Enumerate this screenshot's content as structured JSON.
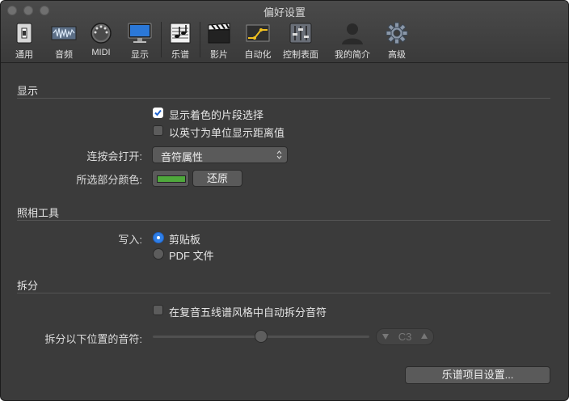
{
  "window": {
    "title": "偏好设置"
  },
  "toolbar": {
    "items": [
      {
        "label": "通用",
        "icon": "general-switch-icon"
      },
      {
        "label": "音频",
        "icon": "audio-waveform-icon"
      },
      {
        "label": "MIDI",
        "icon": "midi-connector-icon"
      },
      {
        "label": "显示",
        "icon": "display-monitor-icon"
      },
      {
        "label": "乐谱",
        "icon": "music-score-icon"
      },
      {
        "label": "影片",
        "icon": "film-clapper-icon"
      },
      {
        "label": "自动化",
        "icon": "automation-icon"
      },
      {
        "label": "控制表面",
        "icon": "control-surface-icon"
      },
      {
        "label": "我的简介",
        "icon": "my-profile-icon"
      },
      {
        "label": "高级",
        "icon": "advanced-gear-icon"
      }
    ],
    "selected": "乐谱"
  },
  "sections": {
    "display": {
      "title": "显示",
      "show_colored_selection": {
        "label": "显示着色的片段选择",
        "checked": true
      },
      "show_inch_distance": {
        "label": "以英寸为单位显示距离值",
        "checked": false
      },
      "double_click_opens": {
        "label": "连按会打开:",
        "value": "音符属性"
      },
      "selection_color": {
        "label": "所选部分颜色:",
        "color": "#4fa83c",
        "reset_label": "还原"
      }
    },
    "camera": {
      "title": "照相工具",
      "write_to": {
        "label": "写入:",
        "options": [
          "剪贴板",
          "PDF 文件"
        ],
        "selected": "剪贴板"
      }
    },
    "split": {
      "title": "拆分",
      "auto_split": {
        "label": "在复音五线谱风格中自动拆分音符",
        "checked": false
      },
      "split_below": {
        "label": "拆分以下位置的音符:",
        "value": "C3",
        "slider_fraction": 0.5
      }
    }
  },
  "footer": {
    "score_project_settings": "乐谱项目设置..."
  },
  "colors": {
    "window_bg": "#3b3b3b",
    "accent": "#2f7fe7",
    "selection_swatch": "#4fa83c"
  }
}
